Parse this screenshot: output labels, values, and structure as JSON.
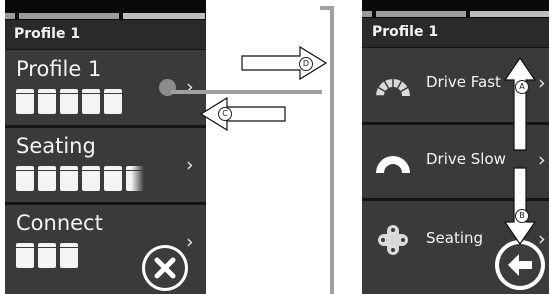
{
  "left_screen": {
    "header": "Profile 1",
    "rows": [
      {
        "title": "Profile 1",
        "cell_count": 5
      },
      {
        "title": "Seating",
        "cell_count": 6
      },
      {
        "title": "Connect",
        "cell_count": 3
      }
    ],
    "close_icon": "close-x-icon"
  },
  "right_screen": {
    "header": "Profile 1",
    "rows": [
      {
        "label": "Drive Fast",
        "icon": "speedometer-fast-icon"
      },
      {
        "label": "Drive Slow",
        "icon": "speedometer-slow-icon"
      },
      {
        "label": "Seating",
        "icon": "dpad-icon"
      }
    ],
    "back_icon": "back-arrow-icon"
  },
  "callouts": {
    "a": "A",
    "b": "B",
    "c": "C",
    "d": "D"
  },
  "colors": {
    "screen_bg": "#141414",
    "row_bg": "#3a3a3a",
    "header_bg": "#2a2a2a",
    "text": "#f4f4f4",
    "connector": "#a0a0a0",
    "selector_dot": "#8c8c8c"
  }
}
